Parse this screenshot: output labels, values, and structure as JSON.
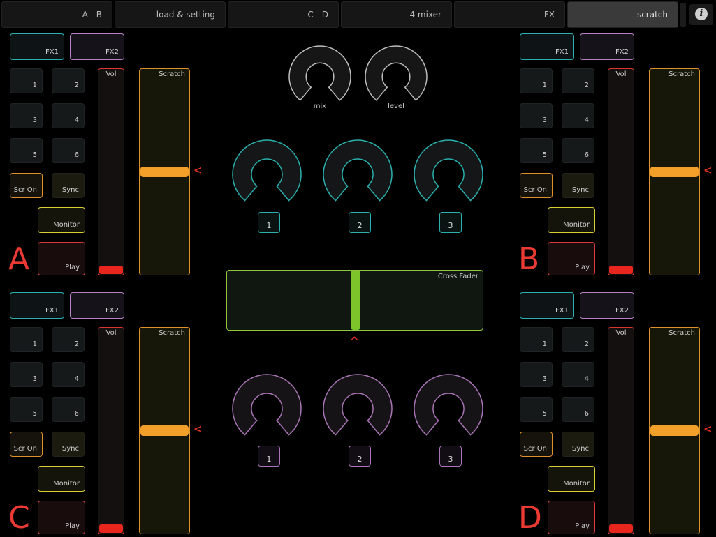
{
  "tabs": [
    {
      "label": "A - B",
      "active": false
    },
    {
      "label": "load & setting",
      "active": false
    },
    {
      "label": "C - D",
      "active": false
    },
    {
      "label": "4 mixer",
      "active": false
    },
    {
      "label": "FX",
      "active": false
    },
    {
      "label": "scratch",
      "active": true
    }
  ],
  "info_glyph": "i",
  "colors": {
    "fx1": "#2ab0ad",
    "fx2": "#b87fc4",
    "scr_on": "#e0912a",
    "monitor": "#d9cf35",
    "play": "#d43a36",
    "vol": "#d8362f",
    "scratch": "#f2a02a",
    "crossfader": "#8ec73a",
    "knob_gray": "#bdbdbd",
    "knob_teal": "#2ab0ad",
    "knob_purple": "#a974b6"
  },
  "deck_common": {
    "fx1": "FX1",
    "fx2": "FX2",
    "pads": [
      "1",
      "2",
      "3",
      "4",
      "5",
      "6"
    ],
    "scr_on": "Scr On",
    "sync": "Sync",
    "monitor": "Monitor",
    "play": "Play",
    "vol_label": "Vol",
    "scratch_label": "Scratch",
    "scratch_indicator": "<"
  },
  "decks": [
    {
      "id": "A",
      "letter": "A",
      "volume": 0.04,
      "scratch_position": 0.5
    },
    {
      "id": "B",
      "letter": "B",
      "volume": 0.04,
      "scratch_position": 0.5
    },
    {
      "id": "C",
      "letter": "C",
      "volume": 0.04,
      "scratch_position": 0.5
    },
    {
      "id": "D",
      "letter": "D",
      "volume": 0.04,
      "scratch_position": 0.5
    }
  ],
  "mixer": {
    "top_knobs": [
      {
        "label": "mix"
      },
      {
        "label": "level"
      }
    ],
    "teal_buttons": [
      "1",
      "2",
      "3"
    ],
    "purple_buttons": [
      "1",
      "2",
      "3"
    ]
  },
  "crossfader": {
    "label": "Cross Fader",
    "position": 0.5,
    "indicator": "^"
  }
}
